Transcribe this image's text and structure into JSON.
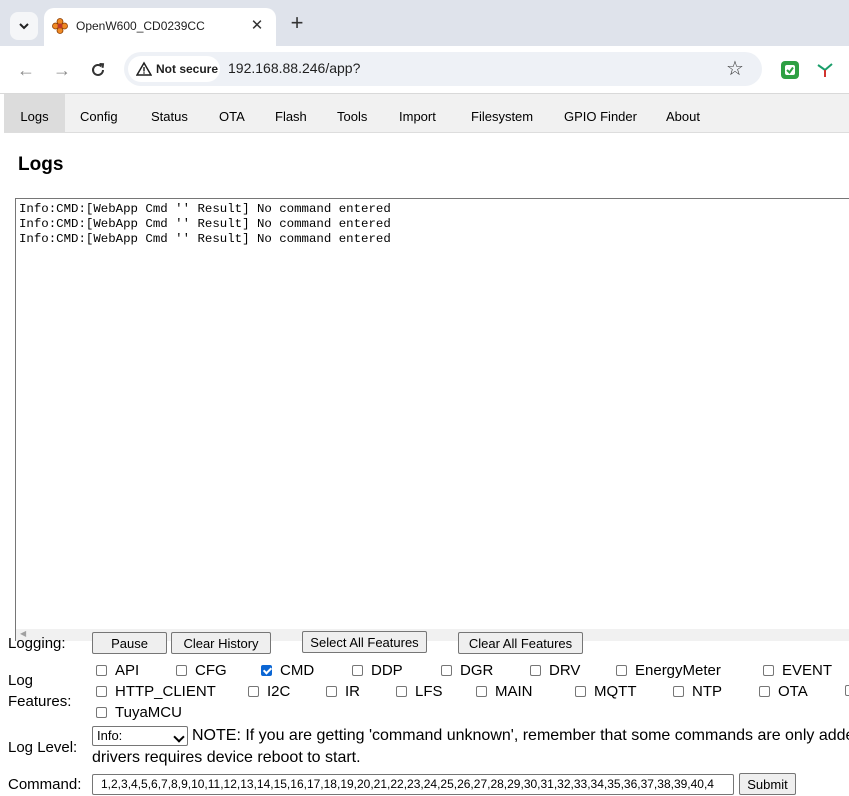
{
  "browser": {
    "tab_title": "OpenW600_CD0239CC",
    "tab_close": "✕",
    "new_tab": "+",
    "security_label": "Not secure",
    "url": "192.168.88.246/app?"
  },
  "nav": {
    "tabs": [
      "Logs",
      "Config",
      "Status",
      "OTA",
      "Flash",
      "Tools",
      "Import",
      "Filesystem",
      "GPIO Finder",
      "About"
    ],
    "active": "Logs"
  },
  "page": {
    "title": "Logs",
    "log_lines": "Info:CMD:[WebApp Cmd '' Result] No command entered\nInfo:CMD:[WebApp Cmd '' Result] No command entered\nInfo:CMD:[WebApp Cmd '' Result] No command entered"
  },
  "logging": {
    "label": "Logging:",
    "pause": "Pause",
    "clear_history": "Clear History",
    "select_all": "Select All Features",
    "clear_all": "Clear All Features"
  },
  "features": {
    "label_line1": "Log",
    "label_line2": "Features:",
    "items": [
      {
        "name": "API",
        "checked": false
      },
      {
        "name": "CFG",
        "checked": false
      },
      {
        "name": "CMD",
        "checked": true
      },
      {
        "name": "DDP",
        "checked": false
      },
      {
        "name": "DGR",
        "checked": false
      },
      {
        "name": "DRV",
        "checked": false
      },
      {
        "name": "EnergyMeter",
        "checked": false
      },
      {
        "name": "EVENT",
        "checked": false
      },
      {
        "name": "HTTP_CLIENT",
        "checked": false
      },
      {
        "name": "I2C",
        "checked": false
      },
      {
        "name": "IR",
        "checked": false
      },
      {
        "name": "LFS",
        "checked": false
      },
      {
        "name": "MAIN",
        "checked": false
      },
      {
        "name": "MQTT",
        "checked": false
      },
      {
        "name": "NTP",
        "checked": false
      },
      {
        "name": "OTA",
        "checked": false
      },
      {
        "name": "TuyaMCU",
        "checked": false
      }
    ]
  },
  "log_level": {
    "label": "Log Level:",
    "selected": "Info:",
    "note_line1": "NOTE: If you are getting 'command unknown', remember that some commands are only adde",
    "note_line2": "drivers requires device reboot to start."
  },
  "command": {
    "label": "Command:",
    "value": "1,2,3,4,5,6,7,8,9,10,11,12,13,14,15,16,17,18,19,20,21,22,23,24,25,26,27,28,29,30,31,32,33,34,35,36,37,38,39,40,4",
    "submit": "Submit"
  }
}
